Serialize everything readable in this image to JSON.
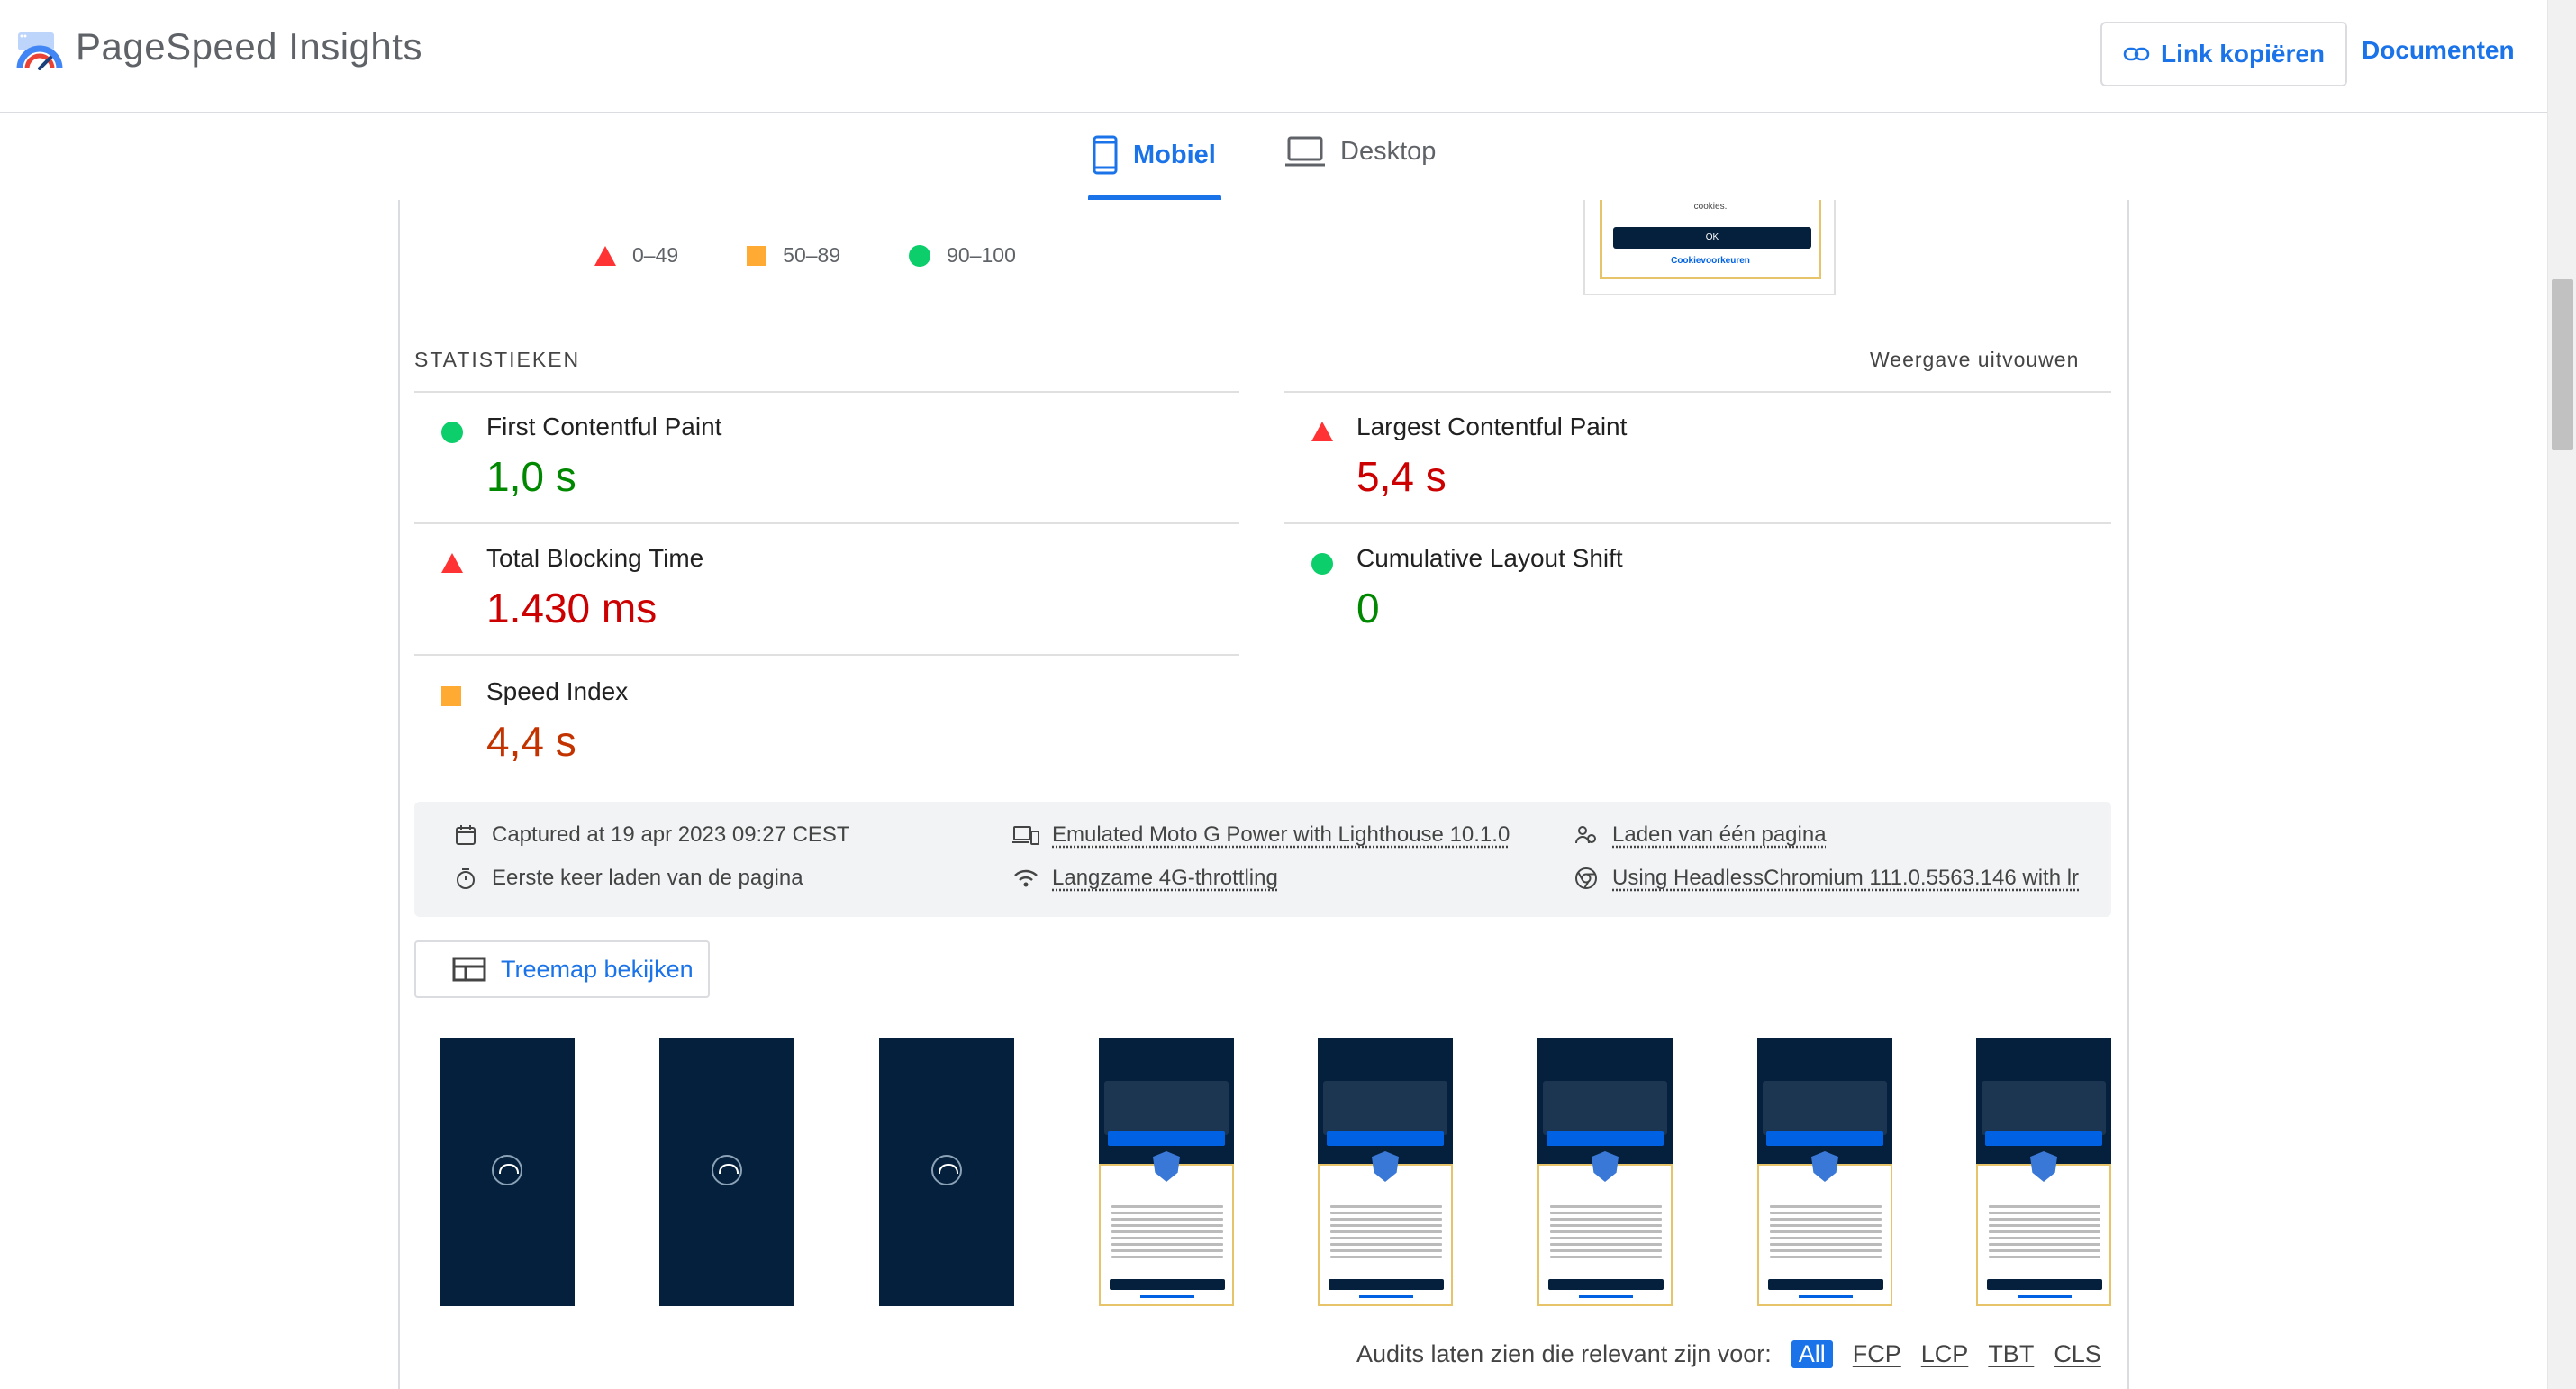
{
  "header": {
    "app_title": "PageSpeed Insights",
    "copy_link_label": "Link kopiëren",
    "docs_label": "Documenten"
  },
  "tabs": [
    {
      "label": "Mobiel",
      "active": true,
      "icon": "smartphone-icon"
    },
    {
      "label": "Desktop",
      "active": false,
      "icon": "laptop-icon"
    }
  ],
  "legend": [
    {
      "range": "0–49",
      "icon": "red-triangle"
    },
    {
      "range": "50–89",
      "icon": "orange-square"
    },
    {
      "range": "90–100",
      "icon": "green-circle"
    }
  ],
  "screenshot_preview": {
    "text": "cookies.",
    "ok": "OK",
    "link": "Cookievoorkeuren"
  },
  "stats": {
    "label": "STATISTIEKEN",
    "expand_label": "Weergave uitvouwen",
    "metrics": [
      {
        "name": "First Contentful Paint",
        "value": "1,0 s",
        "rating": "good"
      },
      {
        "name": "Largest Contentful Paint",
        "value": "5,4 s",
        "rating": "bad"
      },
      {
        "name": "Total Blocking Time",
        "value": "1.430 ms",
        "rating": "bad"
      },
      {
        "name": "Cumulative Layout Shift",
        "value": "0",
        "rating": "good"
      },
      {
        "name": "Speed Index",
        "value": "4,4 s",
        "rating": "average"
      }
    ]
  },
  "colors": {
    "good": "#0cce6b",
    "average": "#ffaa33",
    "bad": "#ff3333",
    "accent": "#1a73e8"
  },
  "run_info": {
    "captured": "Captured at 19 apr 2023 09:27 CEST",
    "first_load": "Eerste keer laden van de pagina",
    "device": "Emulated Moto G Power with Lighthouse 10.1.0",
    "throttling": "Langzame 4G-throttling",
    "page_load": "Laden van één pagina",
    "browser": "Using HeadlessChromium 111.0.5563.146 with lr"
  },
  "treemap_label": "Treemap bekijken",
  "filmstrip": {
    "loading_frames": 3,
    "loaded_frames": 5
  },
  "audits": {
    "label": "Audits laten zien die relevant zijn voor:",
    "filters": [
      "All",
      "FCP",
      "LCP",
      "TBT",
      "CLS"
    ],
    "active": "All"
  }
}
